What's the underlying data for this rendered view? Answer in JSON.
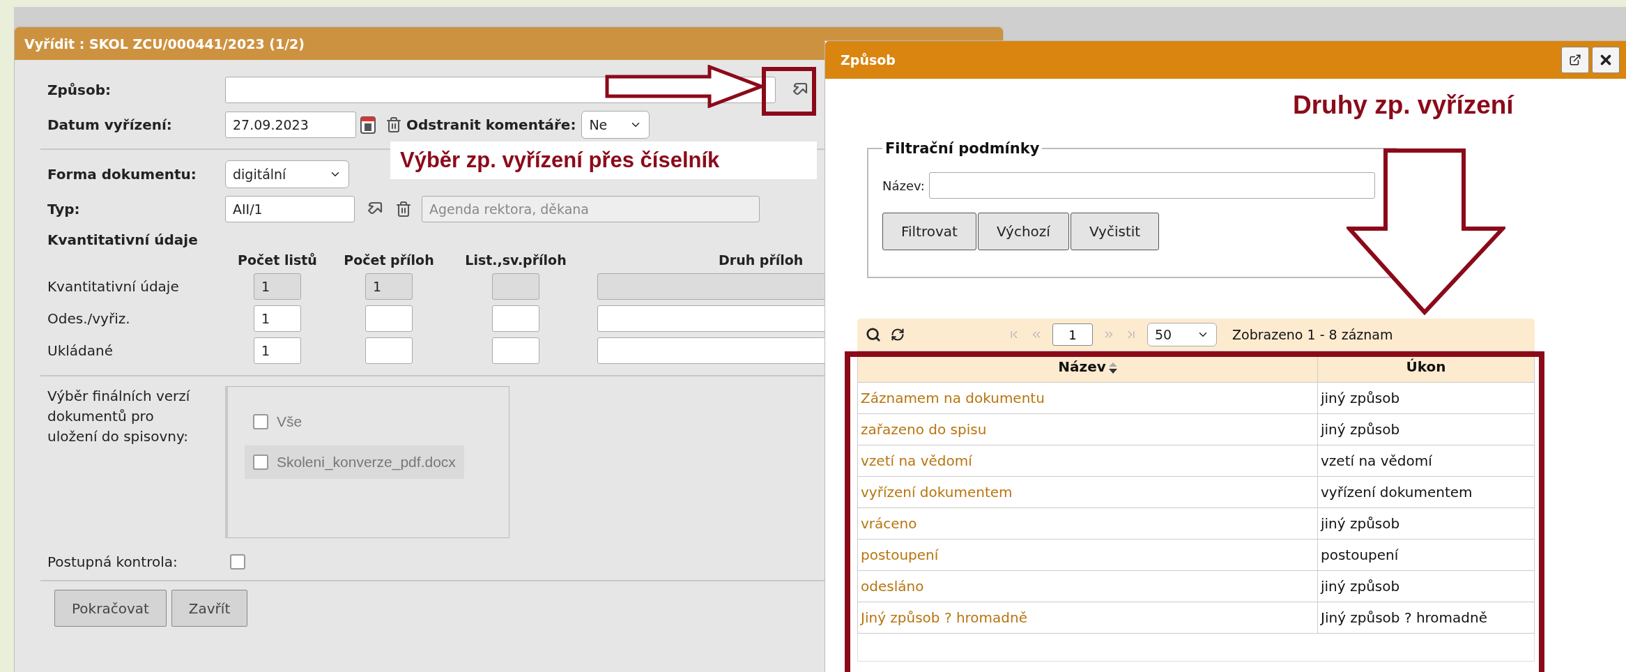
{
  "main_dialog": {
    "title": "Vyřídit : SKOL ZCU/000441/2023 (1/2)",
    "manner": {
      "label": "Způsob:"
    },
    "date": {
      "label": "Datum vyřízení:",
      "value": "27.09.2023"
    },
    "remove_comments": {
      "label": "Odstranit komentáře:",
      "value": "Ne"
    },
    "document_form": {
      "label": "Forma dokumentu:",
      "value": "digitální"
    },
    "type": {
      "label": "Typ:",
      "value": "AII/1",
      "description": "Agenda rektora, děkana"
    },
    "quantitative": {
      "heading": "Kvantitativní údaje",
      "columns": [
        "Počet listů",
        "Počet příloh",
        "List.,sv.příloh",
        "Druh příloh"
      ],
      "rows": [
        {
          "label": "Kvantitativní údaje",
          "disabled": true,
          "values": [
            "1",
            "1"
          ]
        },
        {
          "label": "Odes./vyřiz.",
          "disabled": false,
          "values": [
            "1"
          ]
        },
        {
          "label": "Ukládané",
          "disabled": false,
          "values": [
            "1"
          ]
        }
      ]
    },
    "final_versions": {
      "label": "Výběr finálních verzí dokumentů pro uložení do spisovny:",
      "options": [
        {
          "label": "Vše",
          "checked": false,
          "highlighted": false
        },
        {
          "label": "Skoleni_konverze_pdf.docx",
          "checked": false,
          "highlighted": true
        }
      ]
    },
    "progressive_check": {
      "label": "Postupná kontrola:",
      "checked": false
    },
    "buttons": [
      "Pokračovat",
      "Zavřít"
    ]
  },
  "picker_dialog": {
    "title": "Způsob",
    "filter": {
      "legend": "Filtrační podmínky",
      "name_label": "Název:",
      "buttons": [
        "Filtrovat",
        "Výchozí",
        "Vyčistit"
      ]
    },
    "pager": {
      "page": "1",
      "page_size": "50",
      "summary": "Zobrazeno 1 - 8 záznam"
    },
    "table": {
      "columns": [
        "Název",
        "Úkon"
      ],
      "rows": [
        {
          "name": "Záznamem na dokumentu",
          "action": "jiný způsob"
        },
        {
          "name": "zařazeno do spisu",
          "action": "jiný způsob"
        },
        {
          "name": "vzetí na vědomí",
          "action": "vzetí na vědomí"
        },
        {
          "name": "vyřízení dokumentem",
          "action": "vyřízení dokumentem"
        },
        {
          "name": "vráceno",
          "action": "jiný způsob"
        },
        {
          "name": "postoupení",
          "action": "postoupení"
        },
        {
          "name": "odesláno",
          "action": "jiný způsob"
        },
        {
          "name": "Jiný způsob ? hromadně",
          "action": "Jiný způsob ? hromadně"
        }
      ]
    }
  },
  "annotations": {
    "picker_note": "Výběr zp. vyřízení přes číselník",
    "list_note": "Druhy zp. vyřízení"
  }
}
